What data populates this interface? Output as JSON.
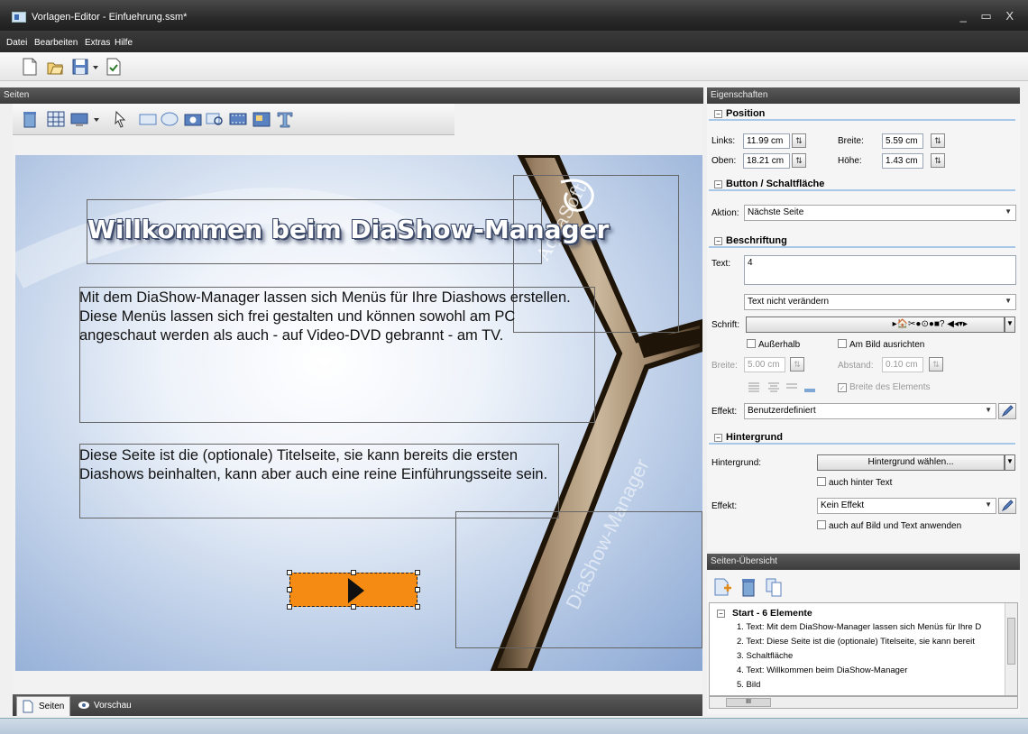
{
  "window": {
    "title": "Vorlagen-Editor - Einfuehrung.ssm*",
    "controls": "_ ▭ X"
  },
  "menu": {
    "items": [
      "Datei",
      "Bearbeiten",
      "Extras",
      "Hilfe"
    ]
  },
  "panes": {
    "pages_header": "Seiten",
    "properties_header": "Eigenschaften",
    "overview_header": "Seiten-Übersicht"
  },
  "slide": {
    "title": "Willkommen beim DiaShow-Manager",
    "paragraph1": "Mit dem DiaShow-Manager lassen sich Menüs für Ihre Diashows erstellen. Diese Menüs lassen sich frei gestalten und können sowohl am PC angeschaut werden als auch - auf Video-DVD gebrannt - am TV.",
    "paragraph2": "Diese Seite ist die (optionale) Titelseite, sie kann bereits die ersten Diashows beinhalten, kann aber auch eine reine Einführungsseite sein.",
    "watermark_top": "AquaSoft",
    "watermark_bottom": "DiaShow-Manager"
  },
  "bottom_tabs": {
    "pages": "Seiten",
    "preview": "Vorschau"
  },
  "properties": {
    "position": {
      "heading": "Position",
      "links_label": "Links:",
      "links_value": "11.99 cm",
      "breite_label": "Breite:",
      "breite_value": "5.59 cm",
      "oben_label": "Oben:",
      "oben_value": "18.21 cm",
      "hoehe_label": "Höhe:",
      "hoehe_value": "1.43 cm"
    },
    "button": {
      "heading": "Button / Schaltfläche",
      "aktion_label": "Aktion:",
      "aktion_value": "Nächste Seite"
    },
    "caption": {
      "heading": "Beschriftung",
      "text_label": "Text:",
      "text_value": "4",
      "text_mode": "Text nicht verändern",
      "schrift_label": "Schrift:",
      "schrift_value": "▸🏠✂●⊙●■?  ◀◂▾▸",
      "ausserhalb": "Außerhalb",
      "am_bild": "Am Bild ausrichten",
      "breite_label": "Breite:",
      "breite_value": "5.00 cm",
      "abstand_label": "Abstand:",
      "abstand_value": "0.10 cm",
      "breite_elements": "Breite des Elements",
      "effekt_label": "Effekt:",
      "effekt_value": "Benutzerdefiniert"
    },
    "background": {
      "heading": "Hintergrund",
      "hintergrund_label": "Hintergrund:",
      "choose_button": "Hintergrund wählen...",
      "behind_text": "auch hinter Text",
      "effekt_label": "Effekt:",
      "effekt_value": "Kein Effekt",
      "apply_all": "auch auf Bild und Text anwenden"
    }
  },
  "overview": {
    "root": "Start - 6 Elemente",
    "items": [
      "1. Text: Mit dem DiaShow-Manager lassen sich Menüs für Ihre D",
      "2. Text: Diese Seite ist die (optionale) Titelseite, sie kann bereit",
      "3. Schaltfläche",
      "4. Text: Willkommen beim DiaShow-Manager",
      "5. Bild"
    ],
    "hscroll_grip": "III"
  },
  "colors": {
    "button_fill": "#f58b12",
    "section_underline": "#a8c8ea",
    "title_bar": "#2a2a2a"
  }
}
